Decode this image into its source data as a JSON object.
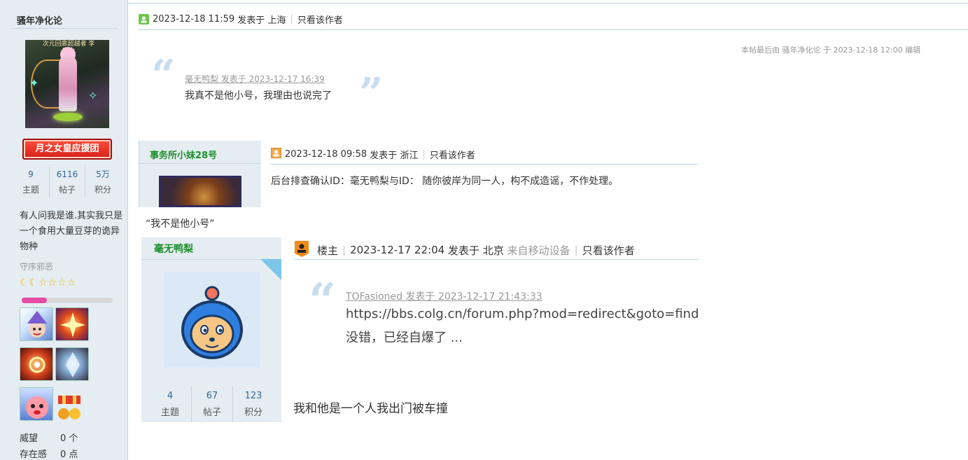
{
  "sidebar": {
    "username": "骚年净化论",
    "avatar_caption": "次元回廊超越者 李宣少",
    "group_badge": "月之女皇应援团",
    "stats": [
      {
        "value": "9",
        "label": "主题"
      },
      {
        "value": "6116",
        "label": "帖子"
      },
      {
        "value": "5万",
        "label": "积分"
      }
    ],
    "intro": "有人问我是谁.其实我只是一个食用大量豆芽的诡异物种",
    "title": "守序邪恶",
    "stars": "☾☾☆☆☆☆",
    "progress_fraction": 0.28,
    "extras": [
      {
        "label": "威望",
        "value": "0 个"
      },
      {
        "label": "存在感",
        "value": "0 点"
      }
    ]
  },
  "post": {
    "time": "2023-12-18 11:59",
    "posted_at_label": "发表于",
    "location": "上海",
    "only_author": "只看该作者",
    "edit_note": "本帖最后由 骚年净化论 于 2023-12-18 12:00 编辑",
    "quote": {
      "author_line": "毫无鸭梨 发表于 2023-12-17 16:39",
      "text": "我真不是他小号，我理由也说完了"
    },
    "after_nested_text": "“我不是他小号”"
  },
  "nested1": {
    "username": "事务所小妹28号",
    "time": "2023-12-18 09:58",
    "posted_at_label": "发表于",
    "location": "浙江",
    "only_author": "只看该作者",
    "content": "后台排查确认ID：毫无鸭梨与ID： 随你彼岸为同一人，构不成造谣，不作处理。"
  },
  "nested2": {
    "username": "毫无鸭梨",
    "floor_label": "楼主",
    "time": "2023-12-17 22:04",
    "posted_at_label": "发表于",
    "location": "北京",
    "device": "来自移动设备",
    "only_author": "只看该作者",
    "stats": [
      {
        "value": "4",
        "label": "主题"
      },
      {
        "value": "67",
        "label": "帖子"
      },
      {
        "value": "123",
        "label": "积分"
      }
    ],
    "quote": {
      "author_line": "TOFasioned 发表于 2023-12-17 21:43:33",
      "line1": "https://bbs.colg.cn/forum.php?mod=redirect&goto=findpost",
      "line2": "没错，已经自爆了 ..."
    },
    "content": "我和他是一个人我出门被车撞"
  },
  "colors": {
    "sidebar_bg": "#e5edf2",
    "border": "#c2d5e3",
    "username_green": "#1c8e2a",
    "stat_blue": "#336699",
    "quote_mark": "#c7dcef",
    "progress_pink": "#e44ba3"
  },
  "icons": {
    "online_floor": "user-online-icon",
    "offline_floor": "user-offline-icon",
    "host": "thread-starter-icon"
  }
}
